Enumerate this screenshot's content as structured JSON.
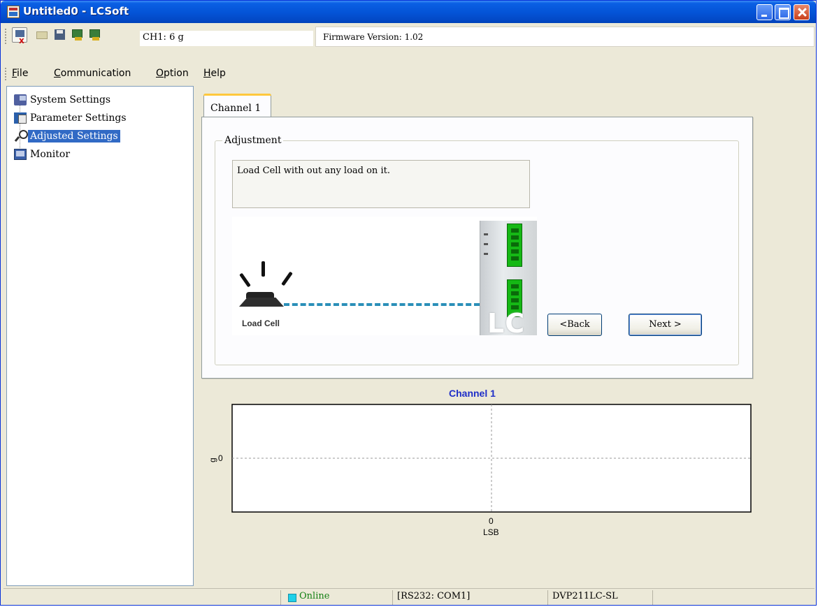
{
  "window": {
    "title": "Untitled0 - LCSoft"
  },
  "toolbar": {
    "icons": [
      "disconnect-icon",
      "open-file-icon",
      "save-icon",
      "upload-icon",
      "download-icon"
    ],
    "channel_label": "CH1:  6 g",
    "firmware_label": "Firmware Version:  1.02"
  },
  "menu": [
    {
      "label": "File",
      "mnemonic": "F"
    },
    {
      "label": "Communication",
      "mnemonic": "C"
    },
    {
      "label": "Option",
      "mnemonic": "O"
    },
    {
      "label": "Help",
      "mnemonic": "H"
    }
  ],
  "tree": {
    "items": [
      {
        "label": "System Settings",
        "icon": "system-settings-icon",
        "selected": false
      },
      {
        "label": "Parameter Settings",
        "icon": "parameter-settings-icon",
        "selected": false
      },
      {
        "label": "Adjusted Settings",
        "icon": "adjusted-settings-icon",
        "selected": true
      },
      {
        "label": "Monitor",
        "icon": "monitor-icon",
        "selected": false
      }
    ]
  },
  "tabs": [
    {
      "label": "Channel 1",
      "active": true
    }
  ],
  "adjustment": {
    "group_label": "Adjustment",
    "instruction": "Load Cell with out any load on it.",
    "diagram_label": "Load Cell",
    "module_mark": "LC",
    "back_button": "<Back",
    "next_button": "Next >"
  },
  "chart_data": {
    "type": "line",
    "title": "Channel 1",
    "xlabel": "LSB",
    "ylabel": "g",
    "x_ticks": [
      "0"
    ],
    "y_ticks": [
      "0"
    ],
    "series": [],
    "grid": "dashed crosshair at origin"
  },
  "status": {
    "led_color": "#1fd0e8",
    "connection": "Online",
    "port": "[RS232: COM1]",
    "model": "DVP211LC-SL"
  },
  "colors": {
    "title_bar": "#0453d6",
    "selection": "#316ac5",
    "chart_title": "#1e2ec8",
    "connector_line": "#2a8fb8",
    "terminal_green": "#15b815"
  }
}
